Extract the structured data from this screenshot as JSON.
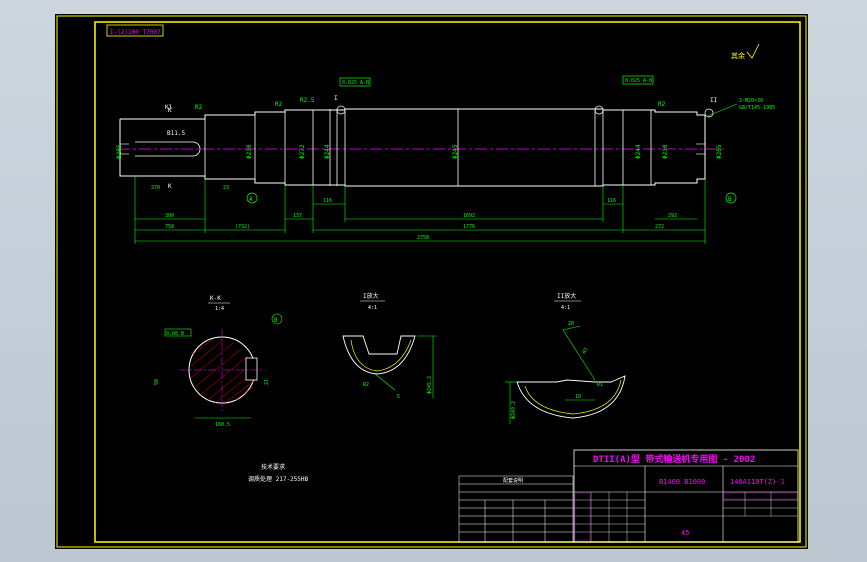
{
  "drawing": {
    "title_block": {
      "title": "DTII(A)型  带式输送机专用图 - 2002",
      "drawing_no": "140A110T(Z)-1",
      "spec": "B1400  B1600",
      "material": "45"
    },
    "corner_label": "I-(2)100 T7007",
    "roughness_note": "其余",
    "shaft": {
      "left_chamfer": "K1",
      "keyway_ref": "B11.5",
      "left_dia": "Φ205",
      "section_label": "K",
      "bearing_seat_label": "Φ230",
      "journal_label": "Φ272",
      "hub_label": "Φ244",
      "center_dia": "Φ245",
      "right_hub_label": "Φ244",
      "right_journal_label": "Φ230",
      "end_dia": "Φ205",
      "ref_a": "A",
      "ref_b": "B",
      "thread_note": "2-M20×30",
      "thread_std": "GB/T145-1985",
      "tol_left": "0.025 A-B",
      "tol_right": "0.025 A-B",
      "r_left": "R2",
      "r_mid": "R2",
      "r_shoulder": "R2.5",
      "r_right": "R2",
      "keyway_len": "270",
      "keyway_depth": "23",
      "dims": {
        "d1": "300",
        "d2": "758",
        "d3": "(732)",
        "d4": "137",
        "d5": "116",
        "d6": "1692",
        "d7": "1776",
        "d8": "116",
        "d9": "272",
        "d10": "292",
        "total": "2758"
      },
      "detail_i": "I",
      "detail_ii": "II"
    },
    "section_kk": {
      "title": "K-K",
      "scale": "1:4",
      "dim_width": "50",
      "dim_depth": "160.5",
      "dim_t": "21",
      "tol": "0.08 B",
      "ref": "B"
    },
    "detail1": {
      "title": "I放大",
      "scale": "4:1",
      "dim_r": "R2",
      "dim_w": "5",
      "dim_d": "Φ245.2"
    },
    "detail2": {
      "title": "II放大",
      "scale": "4:1",
      "dim_a": "20",
      "dim_b": "R3",
      "dim_c": "10",
      "dim_d": "Φ249.2",
      "dim_e": "R1"
    },
    "tech_req": {
      "heading": "技术要求",
      "line1": "调质处理  217-255HB"
    },
    "param_table": {
      "heading": "配套说明"
    }
  },
  "colors": {
    "outline": "#ffffff",
    "dimension": "#00ff00",
    "center": "#ff00ff",
    "border": "#ffff00",
    "titletext": "#ff00ff",
    "hatch": "#ff0000"
  }
}
